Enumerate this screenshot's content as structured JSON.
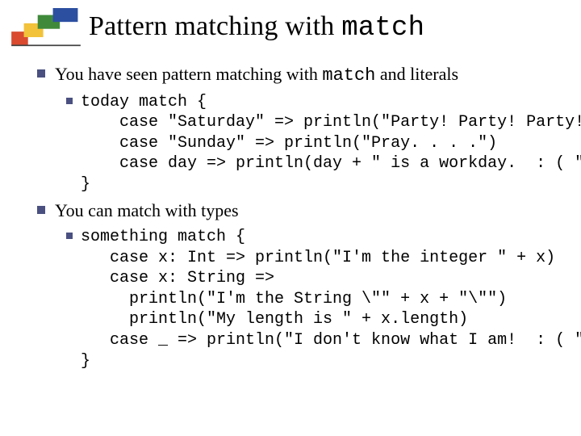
{
  "title": {
    "prefix": "Pattern matching with ",
    "mono": "match"
  },
  "bullets": {
    "b1": {
      "prefix": "You have seen pattern matching with ",
      "mono": "match",
      "suffix": " and literals"
    },
    "code1": "today match {\n    case \"Saturday\" => println(\"Party! Party! Party!\")\n    case \"Sunday\" => println(\"Pray. . . .\")\n    case day => println(day + \" is a workday.  : ( \")\n}",
    "b2": "You can match with types",
    "code2": "something match {\n   case x: Int => println(\"I'm the integer \" + x)\n   case x: String =>\n     println(\"I'm the String \\\"\" + x + \"\\\"\")\n     println(\"My length is \" + x.length)\n   case _ => println(\"I don't know what I am!  : ( \")\n}"
  }
}
